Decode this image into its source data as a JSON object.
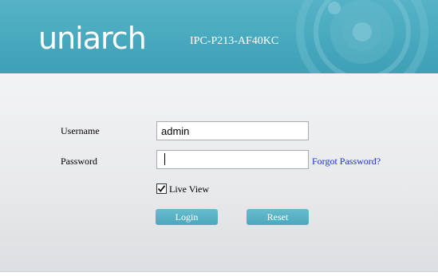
{
  "header": {
    "logo_text": "uniarch",
    "model": "IPC-P213-AF40KC"
  },
  "form": {
    "username_label": "Username",
    "username_value": "admin",
    "password_label": "Password",
    "password_value": "",
    "forgot_password": "Forgot Password?",
    "live_view_label": "Live View",
    "live_view_checked": true,
    "login_button": "Login",
    "reset_button": "Reset"
  },
  "colors": {
    "header_bg": "#48a9be",
    "button_bg": "#4ca8bd",
    "link": "#1a2fd3"
  }
}
